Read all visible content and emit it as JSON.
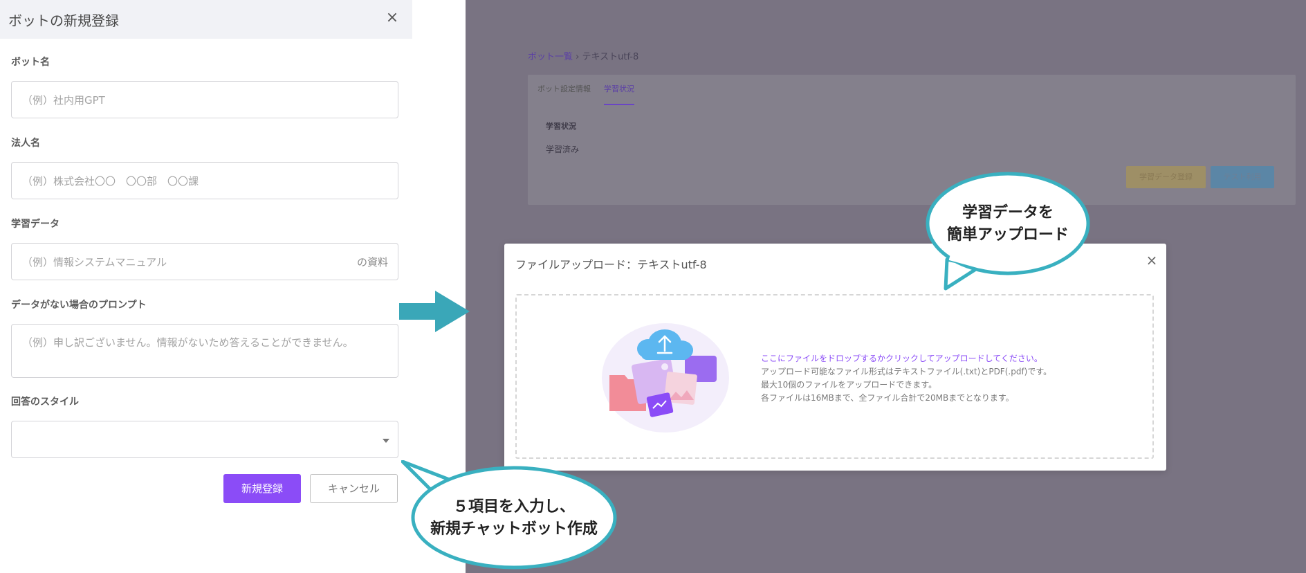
{
  "form": {
    "title": "ボットの新規登録",
    "close_icon": "×",
    "fields": [
      {
        "label": "ボット名",
        "placeholder": "（例）社内用GPT"
      },
      {
        "label": "法人名",
        "placeholder": "（例）株式会社〇〇　〇〇部　〇〇課"
      },
      {
        "label": "学習データ",
        "placeholder": "（例）情報システムマニュアル",
        "suffix": "の資料"
      },
      {
        "label": "データがない場合のプロンプト",
        "placeholder": "（例）申し訳ございません。情報がないため答えることができません。"
      },
      {
        "label": "回答のスタイル",
        "value": ""
      }
    ],
    "submit_label": "新規登録",
    "cancel_label": "キャンセル"
  },
  "background": {
    "breadcrumb": {
      "link": "ボット一覧",
      "separator": "›",
      "current": "テキストutf-8"
    },
    "tabs": [
      "ボット設定情報",
      "学習状況"
    ],
    "status_label": "学習状況",
    "status_value": "学習済み",
    "buttons": [
      "学習データ登録",
      "テスト利用"
    ]
  },
  "modal": {
    "title": "ファイルアップロード：テキストutf-8",
    "close_icon": "×",
    "lines": [
      "ここにファイルをドロップするかクリックしてアップロードしてください。",
      "アップロード可能なファイル形式はテキストファイル(.txt)とPDF(.pdf)です。",
      "最大10個のファイルをアップロードできます。",
      "各ファイルは16MBまで、全ファイル合計で20MBまでとなります。"
    ]
  },
  "callouts": {
    "top": [
      "学習データを",
      "簡単アップロード"
    ],
    "bottom": [
      "５項目を入力し、",
      "新規チャットボット作成"
    ]
  },
  "colors": {
    "accent": "#8b4cf7",
    "overlay": "#797382",
    "callout_border": "#39b0c0",
    "arrow": "#3aa7b8"
  }
}
